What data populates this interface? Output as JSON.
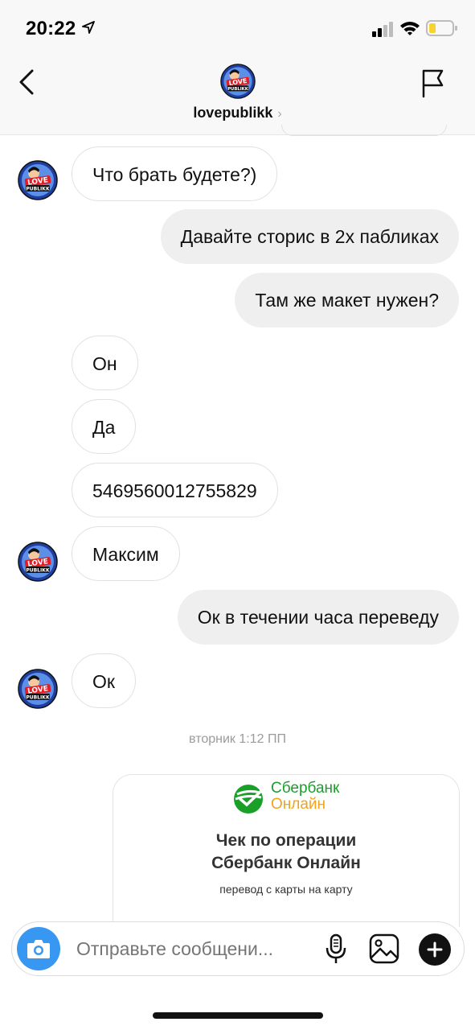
{
  "status_bar": {
    "time": "20:22"
  },
  "header": {
    "username": "lovepublikk",
    "chevron": "›"
  },
  "messages": [
    {
      "text": "Что брать будете?)",
      "direction": "incoming"
    },
    {
      "text": "Давайте сторис в 2х пабликах",
      "direction": "outgoing"
    },
    {
      "text": "Там же макет нужен?",
      "direction": "outgoing"
    },
    {
      "text": "Он",
      "direction": "incoming"
    },
    {
      "text": "Да",
      "direction": "incoming"
    },
    {
      "text": "5469560012755829",
      "direction": "incoming"
    },
    {
      "text": "Максим",
      "direction": "incoming"
    },
    {
      "text": "Ок в течении часа переведу",
      "direction": "outgoing"
    },
    {
      "text": "Ок",
      "direction": "incoming"
    }
  ],
  "timestamp": "вторник 1:12 ПП",
  "receipt": {
    "brand_line1": "Сбербанк",
    "brand_line2": "Онлайн",
    "title_line1": "Чек по операции",
    "title_line2": "Сбербанк Онлайн",
    "subtitle": "перевод с карты на карту"
  },
  "composer": {
    "placeholder": "Отправьте сообщени..."
  },
  "avatar_logo_text": {
    "top": "LOVE",
    "bottom": "PUBLIKK"
  },
  "colors": {
    "accent": "#3897f0",
    "sber_green": "#1a9f29",
    "sber_orange": "#f2a31a",
    "outgoing_bubble": "#efefef"
  },
  "icons": [
    "location-arrow-icon",
    "signal-icon",
    "wifi-icon",
    "battery-icon",
    "back-chevron-icon",
    "flag-icon",
    "camera-icon",
    "microphone-icon",
    "gallery-icon",
    "plus-icon",
    "sberbank-logo-icon"
  ]
}
